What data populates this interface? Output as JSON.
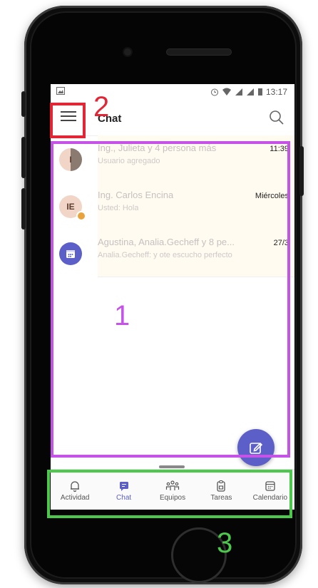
{
  "status_bar": {
    "time": "13:17"
  },
  "header": {
    "title": "Chat"
  },
  "chats": [
    {
      "initials": "I",
      "name": "Ing., Julieta y 4 persona más",
      "preview": "Usuario agregado",
      "time": "11:39",
      "avatar": "photo"
    },
    {
      "initials": "IE",
      "name": "Ing. Carlos Encina",
      "preview": "Usted: Hola",
      "time": "Miércoles",
      "avatar": "initials"
    },
    {
      "initials": "",
      "name": "Agustina, Analia.Gecheff y 8 pe...",
      "preview": "Analia.Gecheff: y ote escucho perfecto",
      "time": "27/3",
      "avatar": "calendar-icon"
    }
  ],
  "tabs": [
    {
      "label": "Actividad",
      "icon": "bell-icon",
      "active": false
    },
    {
      "label": "Chat",
      "icon": "chat-icon",
      "active": true
    },
    {
      "label": "Equipos",
      "icon": "teams-icon",
      "active": false
    },
    {
      "label": "Tareas",
      "icon": "tasks-icon",
      "active": false
    },
    {
      "label": "Calendario",
      "icon": "calendar-icon",
      "active": false
    }
  ],
  "annotations": [
    {
      "number": "1",
      "color": "#c653e8"
    },
    {
      "number": "2",
      "color": "#e32636"
    },
    {
      "number": "3",
      "color": "#4cc94c"
    }
  ],
  "colors": {
    "accent": "#5b5fc7"
  }
}
